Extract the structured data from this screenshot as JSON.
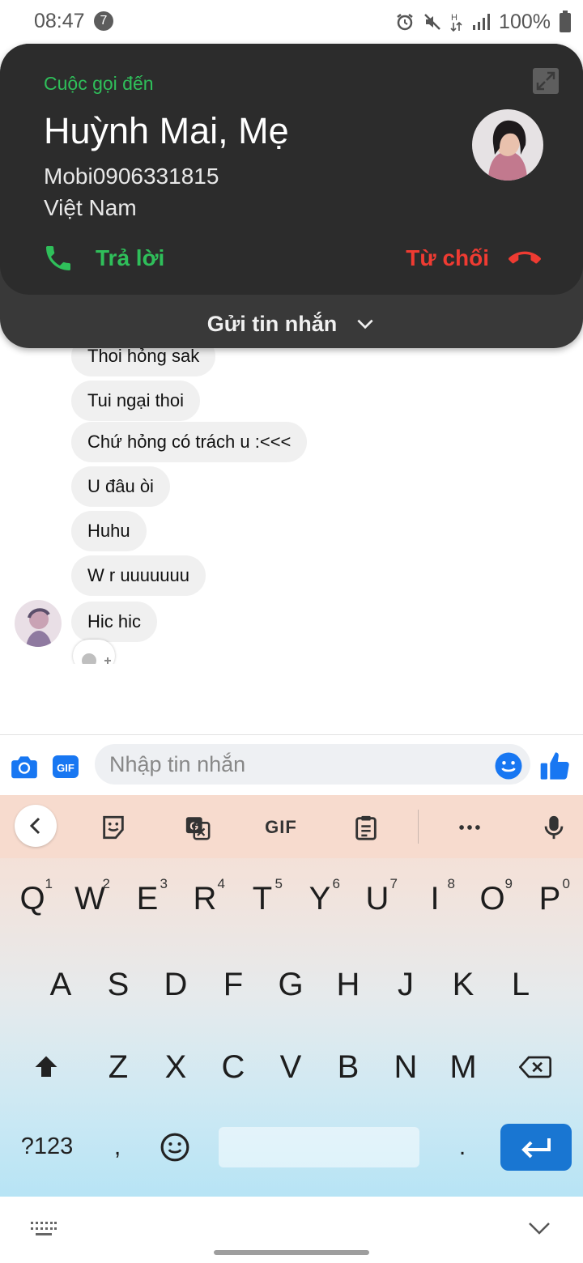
{
  "status_bar": {
    "time": "08:47",
    "notification_count": "7",
    "battery": "100%",
    "icons": [
      "alarm-icon",
      "mute-icon",
      "h-plus-data-icon",
      "signal-icon",
      "battery-icon"
    ]
  },
  "incoming_call": {
    "label": "Cuộc gọi đến",
    "caller_name": "Huỳnh Mai, Mẹ",
    "number": "Mobi0906331815",
    "country": "Việt Nam",
    "answer_label": "Trả lời",
    "decline_label": "Từ chối",
    "send_message_label": "Gửi tin nhắn",
    "colors": {
      "answer": "#2fbf5a",
      "decline": "#ef3b32",
      "card": "#2c2c2c"
    }
  },
  "chat": {
    "messages": [
      "Thoi hỏng sak",
      "Tui ngại thoi",
      "Chứ hỏng có trách u :<<<",
      "U đâu òi",
      "Huhu",
      "W r uuuuuuu",
      "Hic hic"
    ]
  },
  "composer": {
    "placeholder": "Nhập tin nhắn",
    "icons": [
      "camera-icon",
      "gif-icon",
      "emoji-icon",
      "thumbs-up-icon"
    ],
    "accent": "#1877f2"
  },
  "keyboard": {
    "toolbar": {
      "gif_label": "GIF"
    },
    "row1": [
      {
        "k": "Q",
        "n": "1"
      },
      {
        "k": "W",
        "n": "2"
      },
      {
        "k": "E",
        "n": "3"
      },
      {
        "k": "R",
        "n": "4"
      },
      {
        "k": "T",
        "n": "5"
      },
      {
        "k": "Y",
        "n": "6"
      },
      {
        "k": "U",
        "n": "7"
      },
      {
        "k": "I",
        "n": "8"
      },
      {
        "k": "O",
        "n": "9"
      },
      {
        "k": "P",
        "n": "0"
      }
    ],
    "row2": [
      "A",
      "S",
      "D",
      "F",
      "G",
      "H",
      "J",
      "K",
      "L"
    ],
    "row3": [
      "Z",
      "X",
      "C",
      "V",
      "B",
      "N",
      "M"
    ],
    "mode_key": "?123",
    "comma": ",",
    "period": "."
  }
}
